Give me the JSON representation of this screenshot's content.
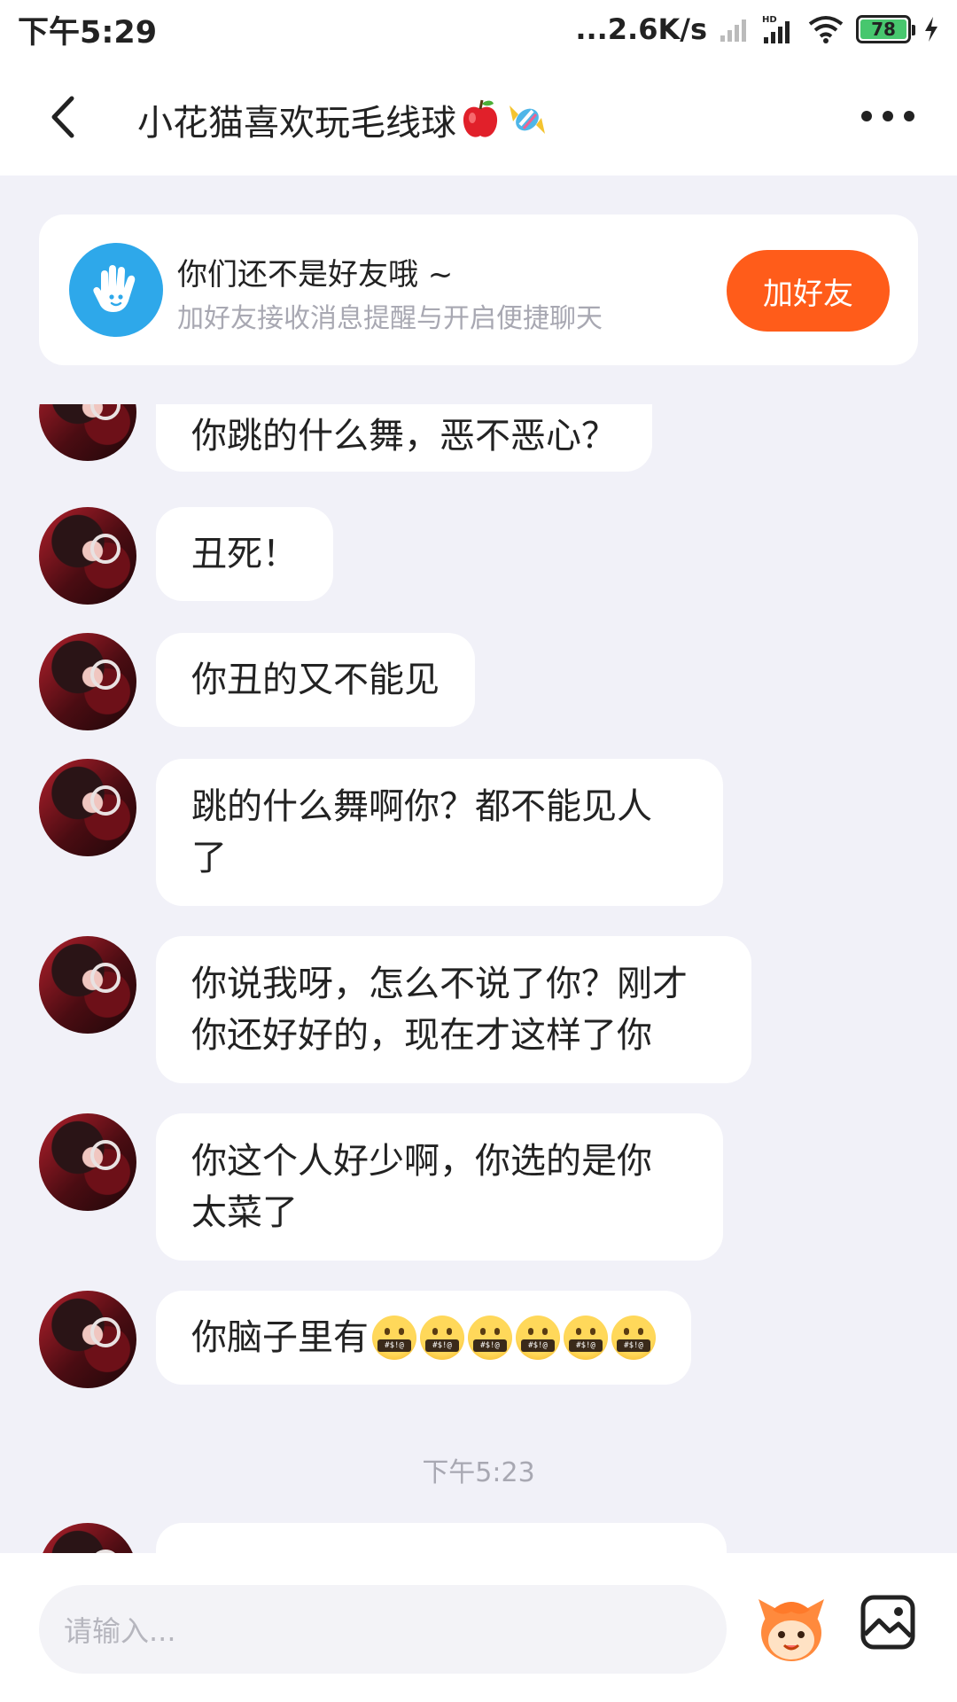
{
  "status_bar": {
    "time": "下午5:29",
    "network_speed": "...2.6K/s",
    "battery": "78"
  },
  "header": {
    "title": "小花猫喜欢玩毛线球"
  },
  "friend_card": {
    "title": "你们还不是好友哦 ~",
    "subtitle": "加好友接收消息提醒与开启便捷聊天",
    "button_label": "加好友"
  },
  "messages": [
    {
      "text": "你跳的什么舞，恶不恶心？"
    },
    {
      "text": "丑死！"
    },
    {
      "text": "你丑的又不能见"
    },
    {
      "text": "跳的什么舞啊你？都不能见人\n了"
    },
    {
      "text": "你说我呀，怎么不说了你？刚才\n你还好好的，现在才这样了你"
    },
    {
      "text": "你这个人好少啊，你选的是你\n太菜了"
    },
    {
      "text": "你脑子里有"
    }
  ],
  "timestamp": "下午5:23",
  "input": {
    "placeholder": "请输入..."
  },
  "colors": {
    "accent_orange": "#ff5c1a",
    "friend_icon_blue": "#2ea8ea",
    "chat_background": "#f1f1f8"
  },
  "icons": {
    "back": "chevron-left-icon",
    "more": "more-dots-icon",
    "friend": "waving-hand-icon",
    "sticker": "sticker-icon",
    "image": "image-icon"
  }
}
